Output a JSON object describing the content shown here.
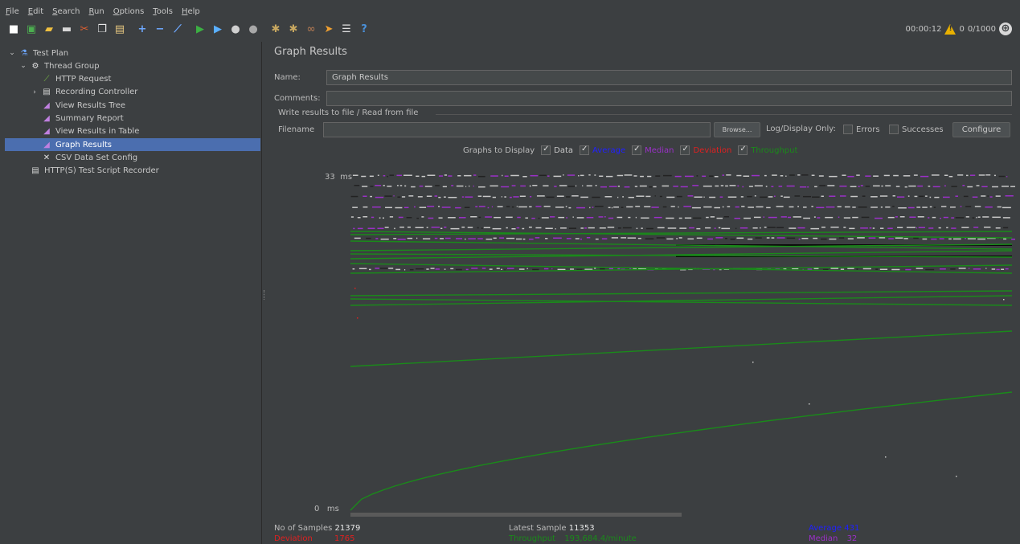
{
  "menu": [
    "File",
    "Edit",
    "Search",
    "Run",
    "Options",
    "Tools",
    "Help"
  ],
  "toolbar": {
    "buttons": [
      {
        "icon": "new-icon",
        "color": "#ffffff",
        "glyph": "■"
      },
      {
        "icon": "templates-icon",
        "color": "#4caf50",
        "glyph": "▣"
      },
      {
        "icon": "open-icon",
        "color": "#f0c040",
        "glyph": "▰"
      },
      {
        "icon": "save-icon",
        "color": "#d8d8d8",
        "glyph": "▬"
      },
      {
        "icon": "cut-icon",
        "color": "#e06030",
        "glyph": "✂"
      },
      {
        "icon": "copy-icon",
        "color": "#e8e8e8",
        "glyph": "❐"
      },
      {
        "icon": "paste-icon",
        "color": "#e8c880",
        "glyph": "▤"
      },
      {
        "icon": "expand-icon",
        "color": "#6ea8ff",
        "glyph": "+"
      },
      {
        "icon": "collapse-icon",
        "color": "#6ea8ff",
        "glyph": "−"
      },
      {
        "icon": "toggle-icon",
        "color": "#6ea8ff",
        "glyph": "⟋"
      },
      {
        "icon": "start-icon",
        "color": "#3cb043",
        "glyph": "▶"
      },
      {
        "icon": "start-no-pauses-icon",
        "color": "#5ab0ff",
        "glyph": "▶"
      },
      {
        "icon": "stop-icon",
        "color": "#d0d0d0",
        "glyph": "●"
      },
      {
        "icon": "shutdown-icon",
        "color": "#a8a8a8",
        "glyph": "●"
      },
      {
        "icon": "clear-icon",
        "color": "#c8a860",
        "glyph": "✱"
      },
      {
        "icon": "clear-all-icon",
        "color": "#c8a860",
        "glyph": "✱"
      },
      {
        "icon": "search-icon",
        "color": "#a07050",
        "glyph": "∞"
      },
      {
        "icon": "reset-search-icon",
        "color": "#f0a030",
        "glyph": "➤"
      },
      {
        "icon": "function-helper-icon",
        "color": "#e0e0e0",
        "glyph": "☰"
      },
      {
        "icon": "help-icon",
        "color": "#4a90d9",
        "glyph": "?"
      }
    ],
    "timer": "00:00:12",
    "warnings": "0",
    "threads": "0/1000"
  },
  "tree": [
    {
      "label": "Test Plan",
      "depth": 0,
      "arrow": "⌄",
      "icon": "test-plan-icon",
      "icon_color": "#6ea8ff",
      "glyph": "⚗",
      "selected": false
    },
    {
      "label": "Thread Group",
      "depth": 1,
      "arrow": "⌄",
      "icon": "thread-group-icon",
      "icon_color": "#e0e0e0",
      "glyph": "⚙",
      "selected": false
    },
    {
      "label": "HTTP Request",
      "depth": 2,
      "arrow": "",
      "icon": "http-request-icon",
      "icon_color": "#7ac043",
      "glyph": "⟋",
      "selected": false
    },
    {
      "label": "Recording Controller",
      "depth": 2,
      "arrow": "›",
      "icon": "recording-controller-icon",
      "icon_color": "#d8d8d8",
      "glyph": "▤",
      "selected": false
    },
    {
      "label": "View Results Tree",
      "depth": 2,
      "arrow": "",
      "icon": "listener-icon",
      "icon_color": "#c080e0",
      "glyph": "◢",
      "selected": false
    },
    {
      "label": "Summary Report",
      "depth": 2,
      "arrow": "",
      "icon": "listener-icon",
      "icon_color": "#c080e0",
      "glyph": "◢",
      "selected": false
    },
    {
      "label": "View Results in Table",
      "depth": 2,
      "arrow": "",
      "icon": "listener-icon",
      "icon_color": "#c080e0",
      "glyph": "◢",
      "selected": false
    },
    {
      "label": "Graph Results",
      "depth": 2,
      "arrow": "",
      "icon": "listener-icon",
      "icon_color": "#c080e0",
      "glyph": "◢",
      "selected": true
    },
    {
      "label": "CSV Data Set Config",
      "depth": 2,
      "arrow": "",
      "icon": "config-element-icon",
      "icon_color": "#e0e0e0",
      "glyph": "✕",
      "selected": false
    },
    {
      "label": "HTTP(S) Test Script Recorder",
      "depth": 1,
      "arrow": "",
      "icon": "recorder-icon",
      "icon_color": "#d8d8d8",
      "glyph": "▤",
      "selected": false
    }
  ],
  "panel": {
    "title": "Graph Results",
    "name_label": "Name:",
    "name_value": "Graph Results",
    "comments_label": "Comments:",
    "comments_value": "",
    "file_group_title": "Write results to file / Read from file",
    "filename_label": "Filename",
    "filename_value": "",
    "browse_label": "Browse...",
    "log_display_label": "Log/Display Only:",
    "errors_label": "Errors",
    "successes_label": "Successes",
    "configure_label": "Configure"
  },
  "graphs_to_display": {
    "label": "Graphs to Display",
    "options": [
      {
        "label": "Data",
        "checked": true,
        "color": "#c8c8c8"
      },
      {
        "label": "Average",
        "checked": true,
        "color": "#2020ff"
      },
      {
        "label": "Median",
        "checked": true,
        "color": "#9b30c8"
      },
      {
        "label": "Deviation",
        "checked": true,
        "color": "#e02020"
      },
      {
        "label": "Throughput",
        "checked": true,
        "color": "#1a8a1a"
      }
    ]
  },
  "graph": {
    "y_max_label": "33",
    "y_min_label": "0",
    "unit": "ms"
  },
  "stats": {
    "samples_label": "No of Samples",
    "samples_value": "21379",
    "latest_label": "Latest Sample",
    "latest_value": "11353",
    "average_label": "Average",
    "average_value": "431",
    "deviation_label": "Deviation",
    "deviation_value": "1765",
    "throughput_label": "Throughput",
    "throughput_value": "193,684.4/minute",
    "median_label": "Median",
    "median_value": "32"
  },
  "colors": {
    "background": "#3c3f41",
    "selection": "#4b6eaf",
    "data": "#c8c8c8",
    "average": "#2020ff",
    "median": "#9b30c8",
    "deviation": "#e02020",
    "throughput": "#1a8a1a"
  }
}
